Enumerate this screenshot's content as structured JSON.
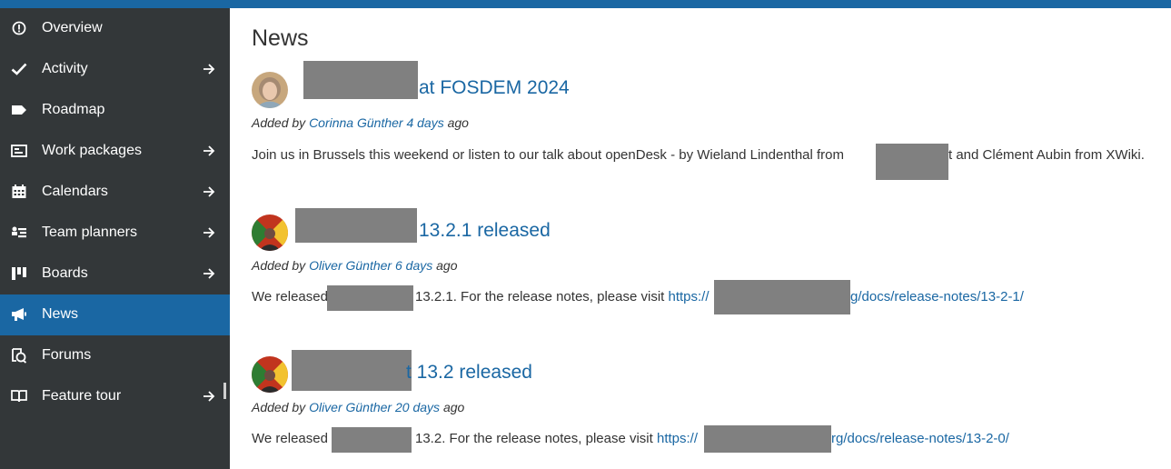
{
  "sidebar": {
    "items": [
      {
        "label": "Overview",
        "icon": "info-icon",
        "active": false,
        "has_arrow": false
      },
      {
        "label": "Activity",
        "icon": "checkmark-icon",
        "active": false,
        "has_arrow": true
      },
      {
        "label": "Roadmap",
        "icon": "tag-icon",
        "active": false,
        "has_arrow": false
      },
      {
        "label": "Work packages",
        "icon": "work-packages-icon",
        "active": false,
        "has_arrow": true
      },
      {
        "label": "Calendars",
        "icon": "calendar-icon",
        "active": false,
        "has_arrow": true
      },
      {
        "label": "Team planners",
        "icon": "team-planner-icon",
        "active": false,
        "has_arrow": true
      },
      {
        "label": "Boards",
        "icon": "boards-icon",
        "active": false,
        "has_arrow": true
      },
      {
        "label": "News",
        "icon": "megaphone-icon",
        "active": true,
        "has_arrow": false
      },
      {
        "label": "Forums",
        "icon": "forums-icon",
        "active": false,
        "has_arrow": false
      },
      {
        "label": "Feature tour",
        "icon": "book-icon",
        "active": false,
        "has_arrow": true
      }
    ]
  },
  "colors": {
    "accent": "#1a67a3",
    "sidebar_bg": "#333739",
    "redaction": "#808080"
  },
  "main": {
    "title": "News",
    "news": [
      {
        "title_visible": "at FOSDEM 2024",
        "added_by_prefix": "Added by",
        "author": "Corinna Günther",
        "time": "4 days",
        "time_suffix": "ago",
        "desc_part1": "Join us in Brussels this weekend or listen to our talk about openDesk - by Wieland Lindenthal from",
        "desc_part2": "t and Clément Aubin from XWiki."
      },
      {
        "title_visible": "13.2.1 released",
        "added_by_prefix": "Added by",
        "author": "Oliver Günther",
        "time": "6 days",
        "time_suffix": "ago",
        "desc_part1": "We released",
        "desc_part2": "13.2.1. For the release notes, please visit",
        "link_part1": "https://",
        "link_part2": "g/docs/release-notes/13-2-1/"
      },
      {
        "title_visible": "t 13.2 released",
        "added_by_prefix": "Added by",
        "author": "Oliver Günther",
        "time": "20 days",
        "time_suffix": "ago",
        "desc_part1": "We released",
        "desc_part2": "13.2. For the release notes, please visit",
        "link_part1": "https://",
        "link_part2": "rg/docs/release-notes/13-2-0/"
      }
    ]
  }
}
